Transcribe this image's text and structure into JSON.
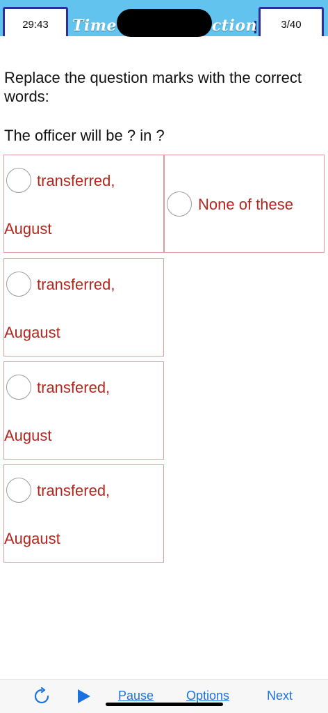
{
  "header": {
    "timer": "29:43",
    "title_left_fragment": "Time",
    "title_right_fragment": "ection",
    "counter": "3/40"
  },
  "question": {
    "prompt": "Replace the question marks with the correct words:",
    "sentence": "The officer will be ? in ?"
  },
  "options": [
    {
      "line1": "transferred,",
      "line2": "August"
    },
    {
      "line1": "None of these"
    },
    {
      "line1": "transferred,",
      "line2": "Augaust"
    },
    {
      "line1": "transfered,",
      "line2": "August"
    },
    {
      "line1": "transfered,",
      "line2": "Augaust"
    }
  ],
  "toolbar": {
    "refresh_icon": "refresh-icon",
    "play_icon": "play-icon",
    "pause_label": "Pause",
    "options_label": "Options",
    "next_label": "Next"
  },
  "colors": {
    "header_bg": "#62c4ee",
    "option_text": "#b3261e",
    "option_border": "#e09a9a",
    "link_blue": "#1a72e0",
    "box_border": "#2a2f9a"
  }
}
